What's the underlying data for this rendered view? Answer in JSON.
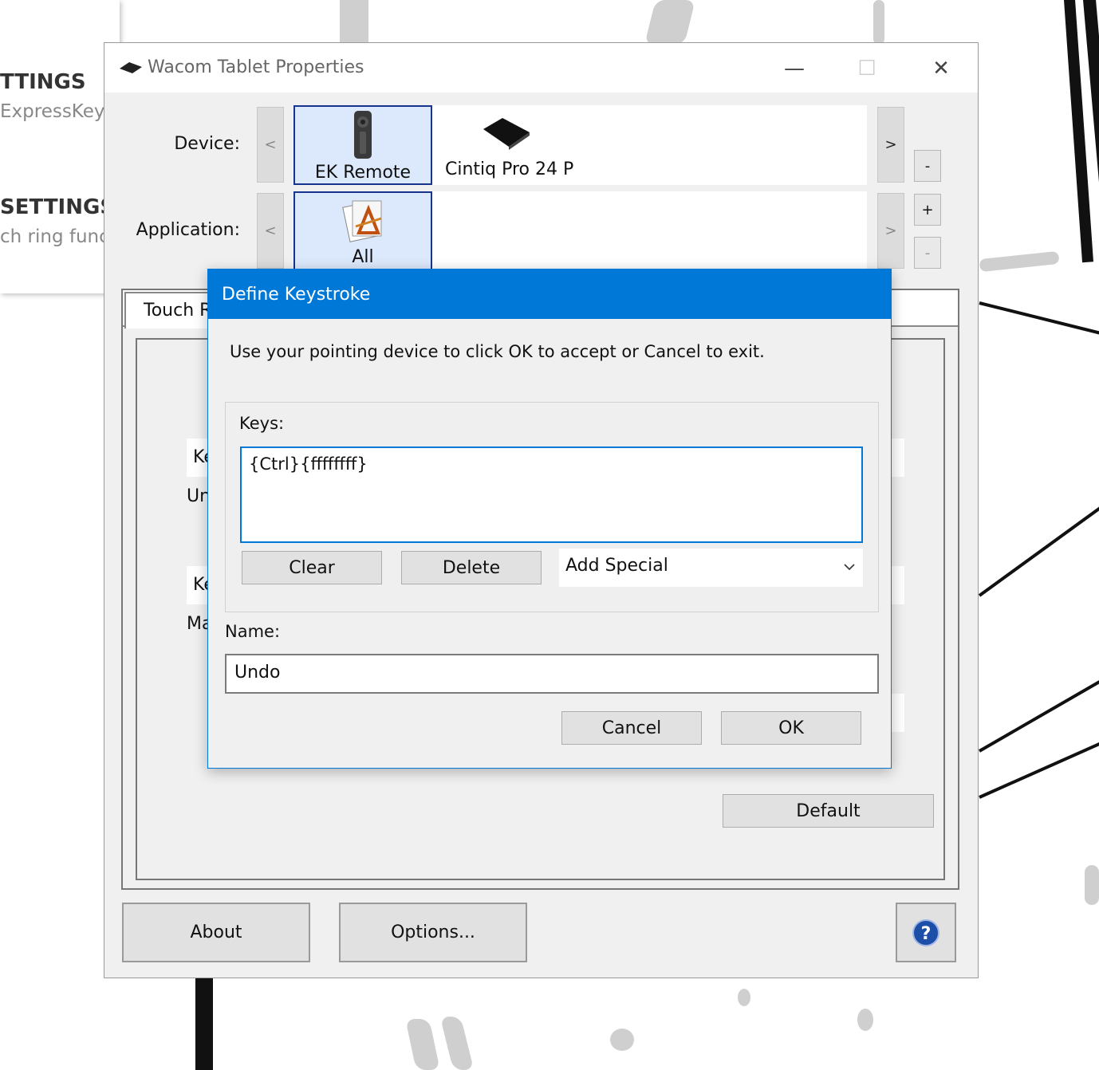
{
  "background": {
    "heading1": "TTINGS",
    "sub1": "ExpressKey f",
    "heading2": "SETTINGS",
    "sub2": "ch ring func"
  },
  "window": {
    "title": "Wacom Tablet Properties",
    "controls": {
      "minimize": "—",
      "maximize": "☐",
      "close": "✕"
    },
    "device_label": "Device:",
    "application_label": "Application:",
    "devices": [
      {
        "label": "EK Remote",
        "selected": true
      },
      {
        "label": "Cintiq Pro 24 P",
        "selected": false
      }
    ],
    "applications": [
      {
        "label": "All",
        "selected": true
      }
    ],
    "scroll_left": "<",
    "scroll_right": ">",
    "device_remove": "-",
    "app_add": "+",
    "app_remove": "-",
    "tab_label": "Touch R",
    "hidden_rows": [
      {
        "field": "Ke",
        "below": "Un"
      },
      {
        "field": "Ke",
        "below": "Ma"
      }
    ],
    "default_button": "Default",
    "about_button": "About",
    "options_button": "Options...",
    "help_icon": "?"
  },
  "dialog": {
    "title": "Define Keystroke",
    "instructions": "Use your pointing device to click OK to accept or Cancel to exit.",
    "keys_label": "Keys:",
    "keys_value": "{Ctrl}{ffffffff}",
    "clear_button": "Clear",
    "delete_button": "Delete",
    "add_special": "Add Special",
    "name_label": "Name:",
    "name_value": "Undo",
    "cancel_button": "Cancel",
    "ok_button": "OK"
  },
  "colors": {
    "accent": "#0078d7",
    "selected_tile": "#dce8fb",
    "selected_border": "#17358f",
    "window_bg": "#f0f0f0"
  }
}
